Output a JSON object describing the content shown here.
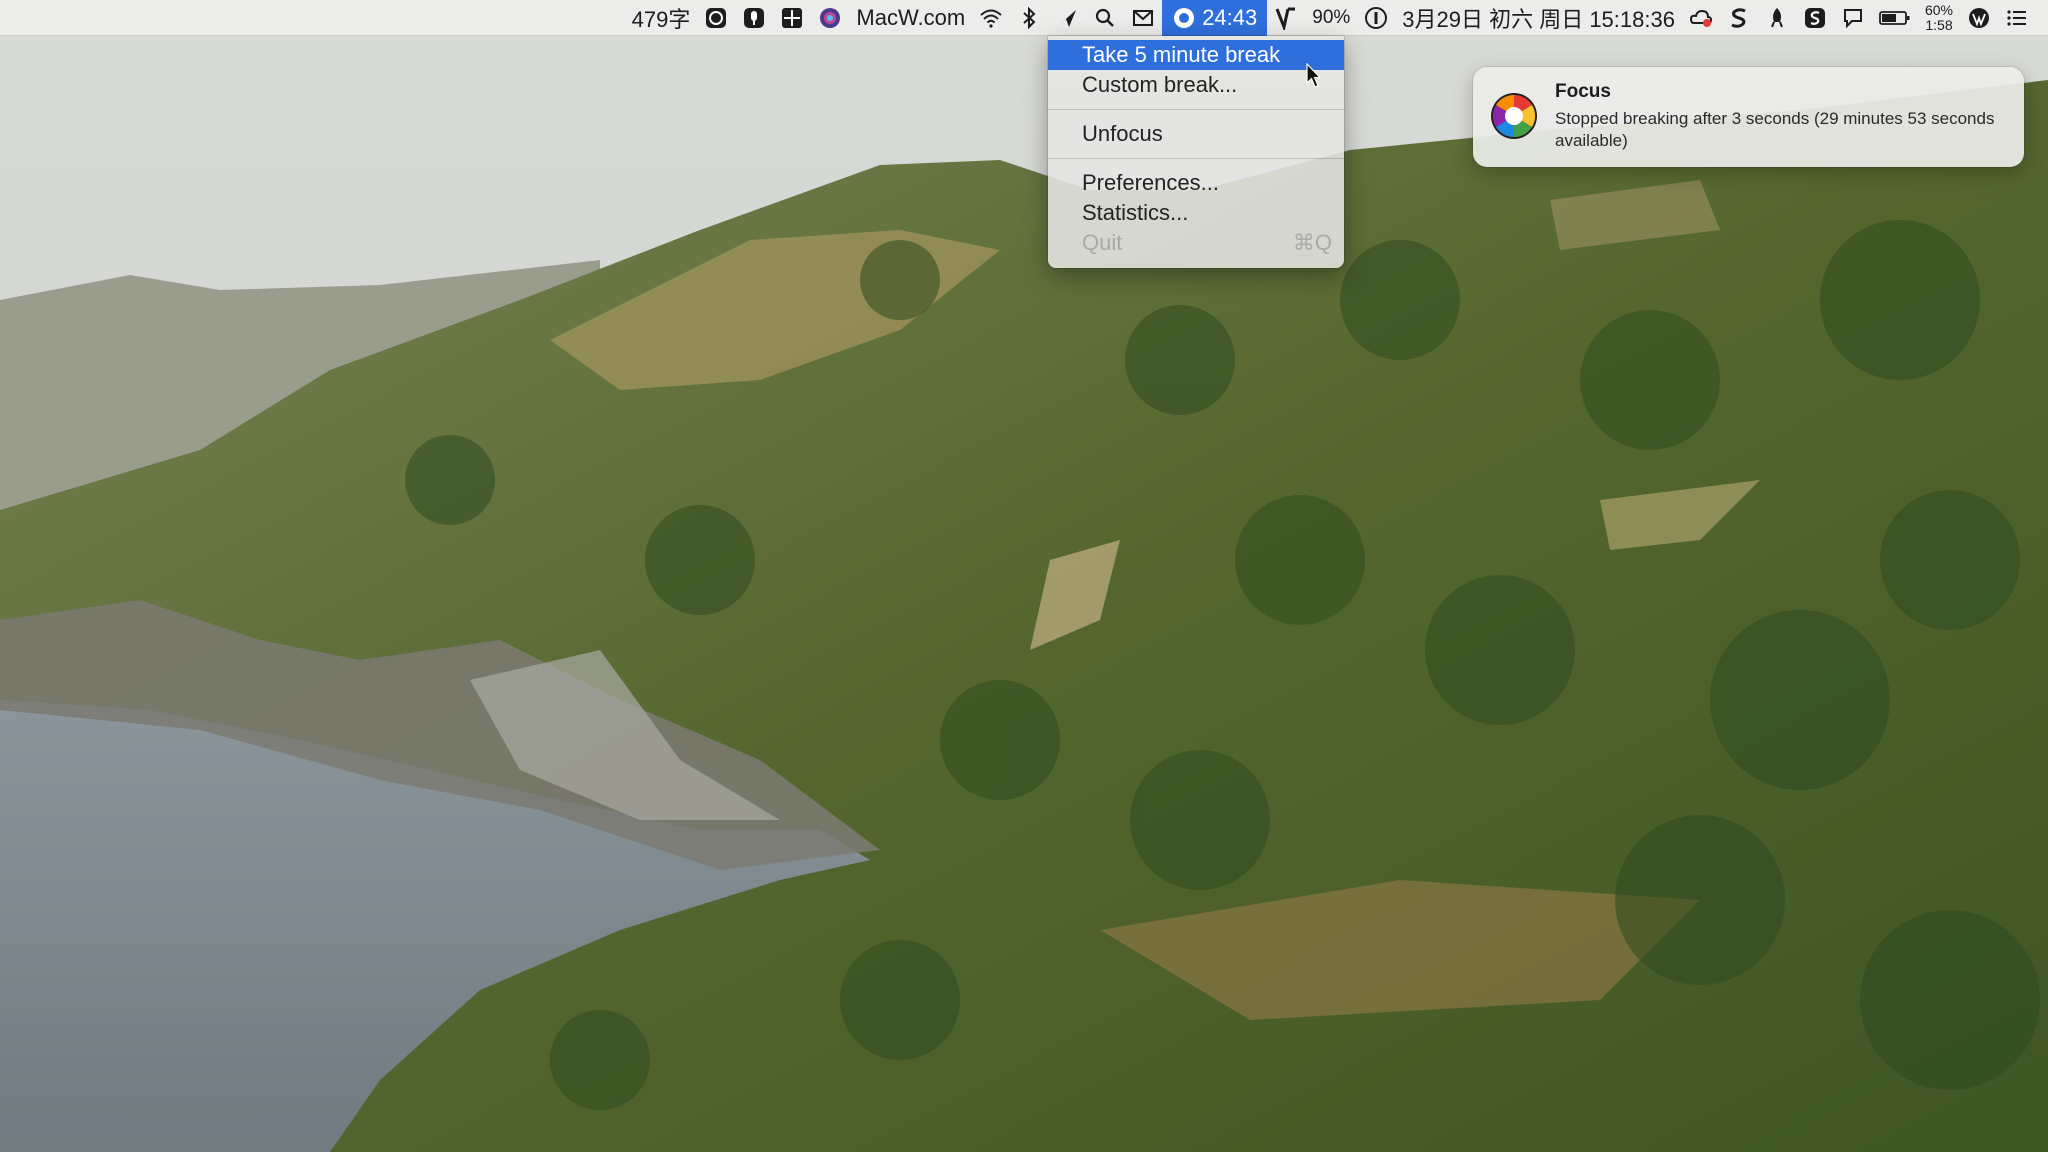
{
  "menubar": {
    "word_count": "479字",
    "site": "MacW.com",
    "focus_timer": "24:43",
    "focus_overlay": "MacW.com",
    "vpn_percent": "90%",
    "datetime": "3月29日 初六 周日 15:18:36",
    "battery_percent": "60%",
    "battery_time": "1:58",
    "icons": [
      "smiley-icon",
      "microphone-icon",
      "grid-icon",
      "siri-icon",
      "wifi-icon",
      "bluetooth-icon",
      "airplane-icon",
      "search-icon",
      "mail-icon",
      "focus-icon",
      "vpn-icon",
      "onepassword-icon",
      "weather-icon",
      "s-icon",
      "rocket-icon",
      "s-square-icon",
      "chat-icon",
      "battery-icon",
      "wordpress-icon",
      "list-icon"
    ]
  },
  "menu": {
    "items": [
      {
        "label": "Take 5 minute break",
        "highlighted": true
      },
      {
        "label": "Custom break..."
      },
      {
        "label": "Unfocus"
      },
      {
        "label": "Preferences..."
      },
      {
        "label": "Statistics..."
      },
      {
        "label": "Quit",
        "shortcut": "⌘Q",
        "disabled": true
      }
    ]
  },
  "notification": {
    "app": "Focus",
    "message": "Stopped breaking after 3 seconds (29 minutes 53 seconds available)"
  },
  "colors": {
    "accent": "#2f6fdc"
  }
}
